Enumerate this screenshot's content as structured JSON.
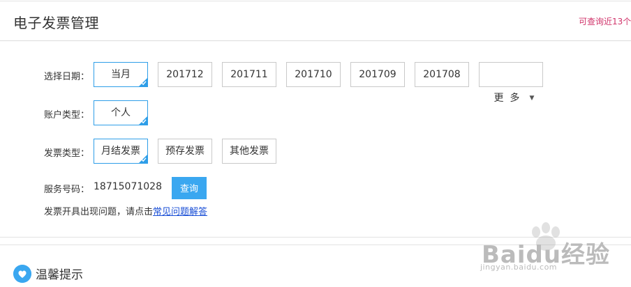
{
  "header": {
    "title": "电子发票管理",
    "note": "可查询近13个"
  },
  "date_row": {
    "label": "选择日期：",
    "options": [
      "当月",
      "201712",
      "201711",
      "201710",
      "201709",
      "201708"
    ],
    "selected": "当月",
    "more_label": "更  多",
    "more_icon": "caret-down-icon"
  },
  "account_row": {
    "label": "账户类型：",
    "options": [
      "个人"
    ],
    "selected": "个人"
  },
  "invoice_row": {
    "label": "发票类型：",
    "options": [
      "月结发票",
      "预存发票",
      "其他发票"
    ],
    "selected": "月结发票"
  },
  "service": {
    "label": "服务号码：",
    "number": "18715071028",
    "query_label": "查询"
  },
  "help": {
    "text": "发票开具出现问题，请点击",
    "link_text": "常见问题解答"
  },
  "tips": {
    "title": "温馨提示",
    "icon": "heart-icon"
  },
  "watermark": {
    "brand": "Baidu经验",
    "url": "jingyan.baidu.com"
  },
  "colors": {
    "accent": "#3aa7f0",
    "selected_border": "#2e9ee8",
    "note": "#d0336a",
    "link": "#1a4fd6"
  }
}
